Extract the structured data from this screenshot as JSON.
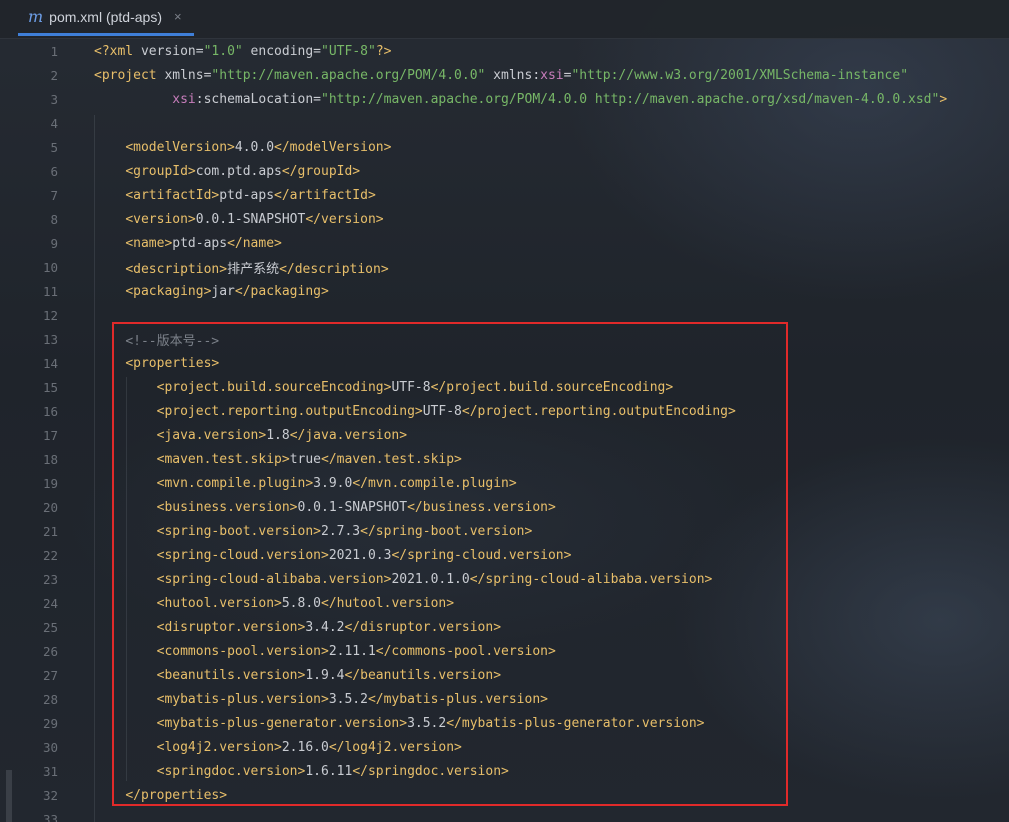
{
  "tab": {
    "icon": "m",
    "title": "pom.xml (ptd-aps)",
    "close": "×"
  },
  "lines": [
    {
      "n": "1",
      "parts": [
        [
          "pi",
          "<?xml "
        ],
        [
          "at",
          "version="
        ],
        [
          "av",
          "\"1.0\""
        ],
        [
          "at",
          " encoding="
        ],
        [
          "av",
          "\"UTF-8\""
        ],
        [
          "pi",
          "?>"
        ]
      ]
    },
    {
      "n": "2",
      "parts": [
        [
          "tg",
          "<project "
        ],
        [
          "at",
          "xmlns="
        ],
        [
          "av",
          "\"http://maven.apache.org/POM/4.0.0\""
        ],
        [
          "at",
          " xmlns:"
        ],
        [
          "ns",
          "xsi"
        ],
        [
          "at",
          "="
        ],
        [
          "av",
          "\"http://www.w3.org/2001/XMLSchema-instance\""
        ]
      ]
    },
    {
      "n": "3",
      "parts": [
        [
          "tx",
          "          "
        ],
        [
          "ns",
          "xsi"
        ],
        [
          "at",
          ":schemaLocation="
        ],
        [
          "av",
          "\"http://maven.apache.org/POM/4.0.0 http://maven.apache.org/xsd/maven-4.0.0.xsd\""
        ],
        [
          "tg",
          ">"
        ]
      ]
    },
    {
      "n": "4",
      "parts": []
    },
    {
      "n": "5",
      "parts": [
        [
          "tx",
          "    "
        ],
        [
          "tg",
          "<modelVersion>"
        ],
        [
          "tx",
          "4.0.0"
        ],
        [
          "tg",
          "</modelVersion>"
        ]
      ]
    },
    {
      "n": "6",
      "parts": [
        [
          "tx",
          "    "
        ],
        [
          "tg",
          "<groupId>"
        ],
        [
          "tx",
          "com.ptd.aps"
        ],
        [
          "tg",
          "</groupId>"
        ]
      ]
    },
    {
      "n": "7",
      "parts": [
        [
          "tx",
          "    "
        ],
        [
          "tg",
          "<artifactId>"
        ],
        [
          "tx",
          "ptd-aps"
        ],
        [
          "tg",
          "</artifactId>"
        ]
      ]
    },
    {
      "n": "8",
      "parts": [
        [
          "tx",
          "    "
        ],
        [
          "tg",
          "<version>"
        ],
        [
          "tx",
          "0.0.1-SNAPSHOT"
        ],
        [
          "tg",
          "</version>"
        ]
      ]
    },
    {
      "n": "9",
      "parts": [
        [
          "tx",
          "    "
        ],
        [
          "tg",
          "<name>"
        ],
        [
          "tx",
          "ptd-aps"
        ],
        [
          "tg",
          "</name>"
        ]
      ]
    },
    {
      "n": "10",
      "parts": [
        [
          "tx",
          "    "
        ],
        [
          "tg",
          "<description>"
        ],
        [
          "tx",
          "排产系统"
        ],
        [
          "tg",
          "</description>"
        ]
      ]
    },
    {
      "n": "11",
      "parts": [
        [
          "tx",
          "    "
        ],
        [
          "tg",
          "<packaging>"
        ],
        [
          "tx",
          "jar"
        ],
        [
          "tg",
          "</packaging>"
        ]
      ]
    },
    {
      "n": "12",
      "parts": []
    },
    {
      "n": "13",
      "parts": [
        [
          "tx",
          "    "
        ],
        [
          "cm",
          "<!--版本号-->"
        ]
      ]
    },
    {
      "n": "14",
      "parts": [
        [
          "tx",
          "    "
        ],
        [
          "tg",
          "<properties>"
        ]
      ]
    },
    {
      "n": "15",
      "parts": [
        [
          "tx",
          "        "
        ],
        [
          "tg",
          "<project.build.sourceEncoding>"
        ],
        [
          "tx",
          "UTF-8"
        ],
        [
          "tg",
          "</project.build.sourceEncoding>"
        ]
      ]
    },
    {
      "n": "16",
      "parts": [
        [
          "tx",
          "        "
        ],
        [
          "tg",
          "<project.reporting.outputEncoding>"
        ],
        [
          "tx",
          "UTF-8"
        ],
        [
          "tg",
          "</project.reporting.outputEncoding>"
        ]
      ]
    },
    {
      "n": "17",
      "parts": [
        [
          "tx",
          "        "
        ],
        [
          "tg",
          "<java.version>"
        ],
        [
          "tx",
          "1.8"
        ],
        [
          "tg",
          "</java.version>"
        ]
      ]
    },
    {
      "n": "18",
      "parts": [
        [
          "tx",
          "        "
        ],
        [
          "tg",
          "<maven.test.skip>"
        ],
        [
          "tx",
          "true"
        ],
        [
          "tg",
          "</maven.test.skip>"
        ]
      ]
    },
    {
      "n": "19",
      "parts": [
        [
          "tx",
          "        "
        ],
        [
          "tg",
          "<mvn.compile.plugin>"
        ],
        [
          "tx",
          "3.9.0"
        ],
        [
          "tg",
          "</mvn.compile.plugin>"
        ]
      ]
    },
    {
      "n": "20",
      "parts": [
        [
          "tx",
          "        "
        ],
        [
          "tg",
          "<business.version>"
        ],
        [
          "tx",
          "0.0.1-SNAPSHOT"
        ],
        [
          "tg",
          "</business.version>"
        ]
      ]
    },
    {
      "n": "21",
      "parts": [
        [
          "tx",
          "        "
        ],
        [
          "tg",
          "<spring-boot.version>"
        ],
        [
          "tx",
          "2.7.3"
        ],
        [
          "tg",
          "</spring-boot.version>"
        ]
      ]
    },
    {
      "n": "22",
      "parts": [
        [
          "tx",
          "        "
        ],
        [
          "tg",
          "<spring-cloud.version>"
        ],
        [
          "tx",
          "2021.0.3"
        ],
        [
          "tg",
          "</spring-cloud.version>"
        ]
      ]
    },
    {
      "n": "23",
      "parts": [
        [
          "tx",
          "        "
        ],
        [
          "tg",
          "<spring-cloud-alibaba.version>"
        ],
        [
          "tx",
          "2021.0.1.0"
        ],
        [
          "tg",
          "</spring-cloud-alibaba.version>"
        ]
      ]
    },
    {
      "n": "24",
      "parts": [
        [
          "tx",
          "        "
        ],
        [
          "tg",
          "<hutool.version>"
        ],
        [
          "tx",
          "5.8.0"
        ],
        [
          "tg",
          "</hutool.version>"
        ]
      ]
    },
    {
      "n": "25",
      "parts": [
        [
          "tx",
          "        "
        ],
        [
          "tg",
          "<disruptor.version>"
        ],
        [
          "tx",
          "3.4.2"
        ],
        [
          "tg",
          "</disruptor.version>"
        ]
      ]
    },
    {
      "n": "26",
      "parts": [
        [
          "tx",
          "        "
        ],
        [
          "tg",
          "<commons-pool.version>"
        ],
        [
          "tx",
          "2.11.1"
        ],
        [
          "tg",
          "</commons-pool.version>"
        ]
      ]
    },
    {
      "n": "27",
      "parts": [
        [
          "tx",
          "        "
        ],
        [
          "tg",
          "<beanutils.version>"
        ],
        [
          "tx",
          "1.9.4"
        ],
        [
          "tg",
          "</beanutils.version>"
        ]
      ]
    },
    {
      "n": "28",
      "parts": [
        [
          "tx",
          "        "
        ],
        [
          "tg",
          "<mybatis-plus.version>"
        ],
        [
          "tx",
          "3.5.2"
        ],
        [
          "tg",
          "</mybatis-plus.version>"
        ]
      ]
    },
    {
      "n": "29",
      "parts": [
        [
          "tx",
          "        "
        ],
        [
          "tg",
          "<mybatis-plus-generator.version>"
        ],
        [
          "tx",
          "3.5.2"
        ],
        [
          "tg",
          "</mybatis-plus-generator.version>"
        ]
      ]
    },
    {
      "n": "30",
      "parts": [
        [
          "tx",
          "        "
        ],
        [
          "tg",
          "<log4j2.version>"
        ],
        [
          "tx",
          "2.16.0"
        ],
        [
          "tg",
          "</log4j2.version>"
        ]
      ]
    },
    {
      "n": "31",
      "parts": [
        [
          "tx",
          "        "
        ],
        [
          "tg",
          "<springdoc.version>"
        ],
        [
          "tx",
          "1.6.11"
        ],
        [
          "tg",
          "</springdoc.version>"
        ]
      ]
    },
    {
      "n": "32",
      "parts": [
        [
          "tx",
          "    "
        ],
        [
          "tg",
          "</properties>"
        ]
      ]
    },
    {
      "n": "33",
      "parts": []
    }
  ]
}
